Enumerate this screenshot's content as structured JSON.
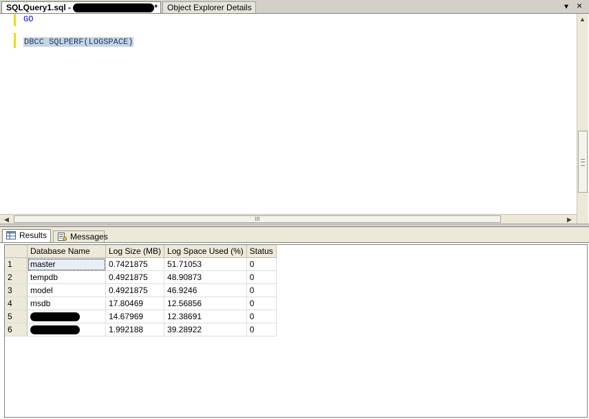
{
  "tabs": {
    "active_label": "SQLQuery1.sql -",
    "active_suffix": "*",
    "inactive_label": "Object Explorer Details",
    "dropdown_glyph": "▾",
    "close_glyph": "×"
  },
  "editor": {
    "lines": [
      "GO",
      "DBCC SQLPERF(LOGSPACE)"
    ],
    "hscroll_grip": "III"
  },
  "results": {
    "tab_results": "Results",
    "tab_messages": "Messages",
    "columns": [
      "Database Name",
      "Log Size (MB)",
      "Log Space Used (%)",
      "Status"
    ],
    "rows": [
      {
        "num": "1",
        "name": "master",
        "size": "0.7421875",
        "used": "51.71053",
        "status": "0",
        "redacted": false
      },
      {
        "num": "2",
        "name": "tempdb",
        "size": "0.4921875",
        "used": "48.90873",
        "status": "0",
        "redacted": false
      },
      {
        "num": "3",
        "name": "model",
        "size": "0.4921875",
        "used": "46.9246",
        "status": "0",
        "redacted": false
      },
      {
        "num": "4",
        "name": "msdb",
        "size": "17.80469",
        "used": "12.56856",
        "status": "0",
        "redacted": false
      },
      {
        "num": "5",
        "name": "",
        "size": "14.67969",
        "used": "12.38691",
        "status": "0",
        "redacted": true
      },
      {
        "num": "6",
        "name": "",
        "size": "1.992188",
        "used": "39.28922",
        "status": "0",
        "redacted": true
      }
    ]
  }
}
